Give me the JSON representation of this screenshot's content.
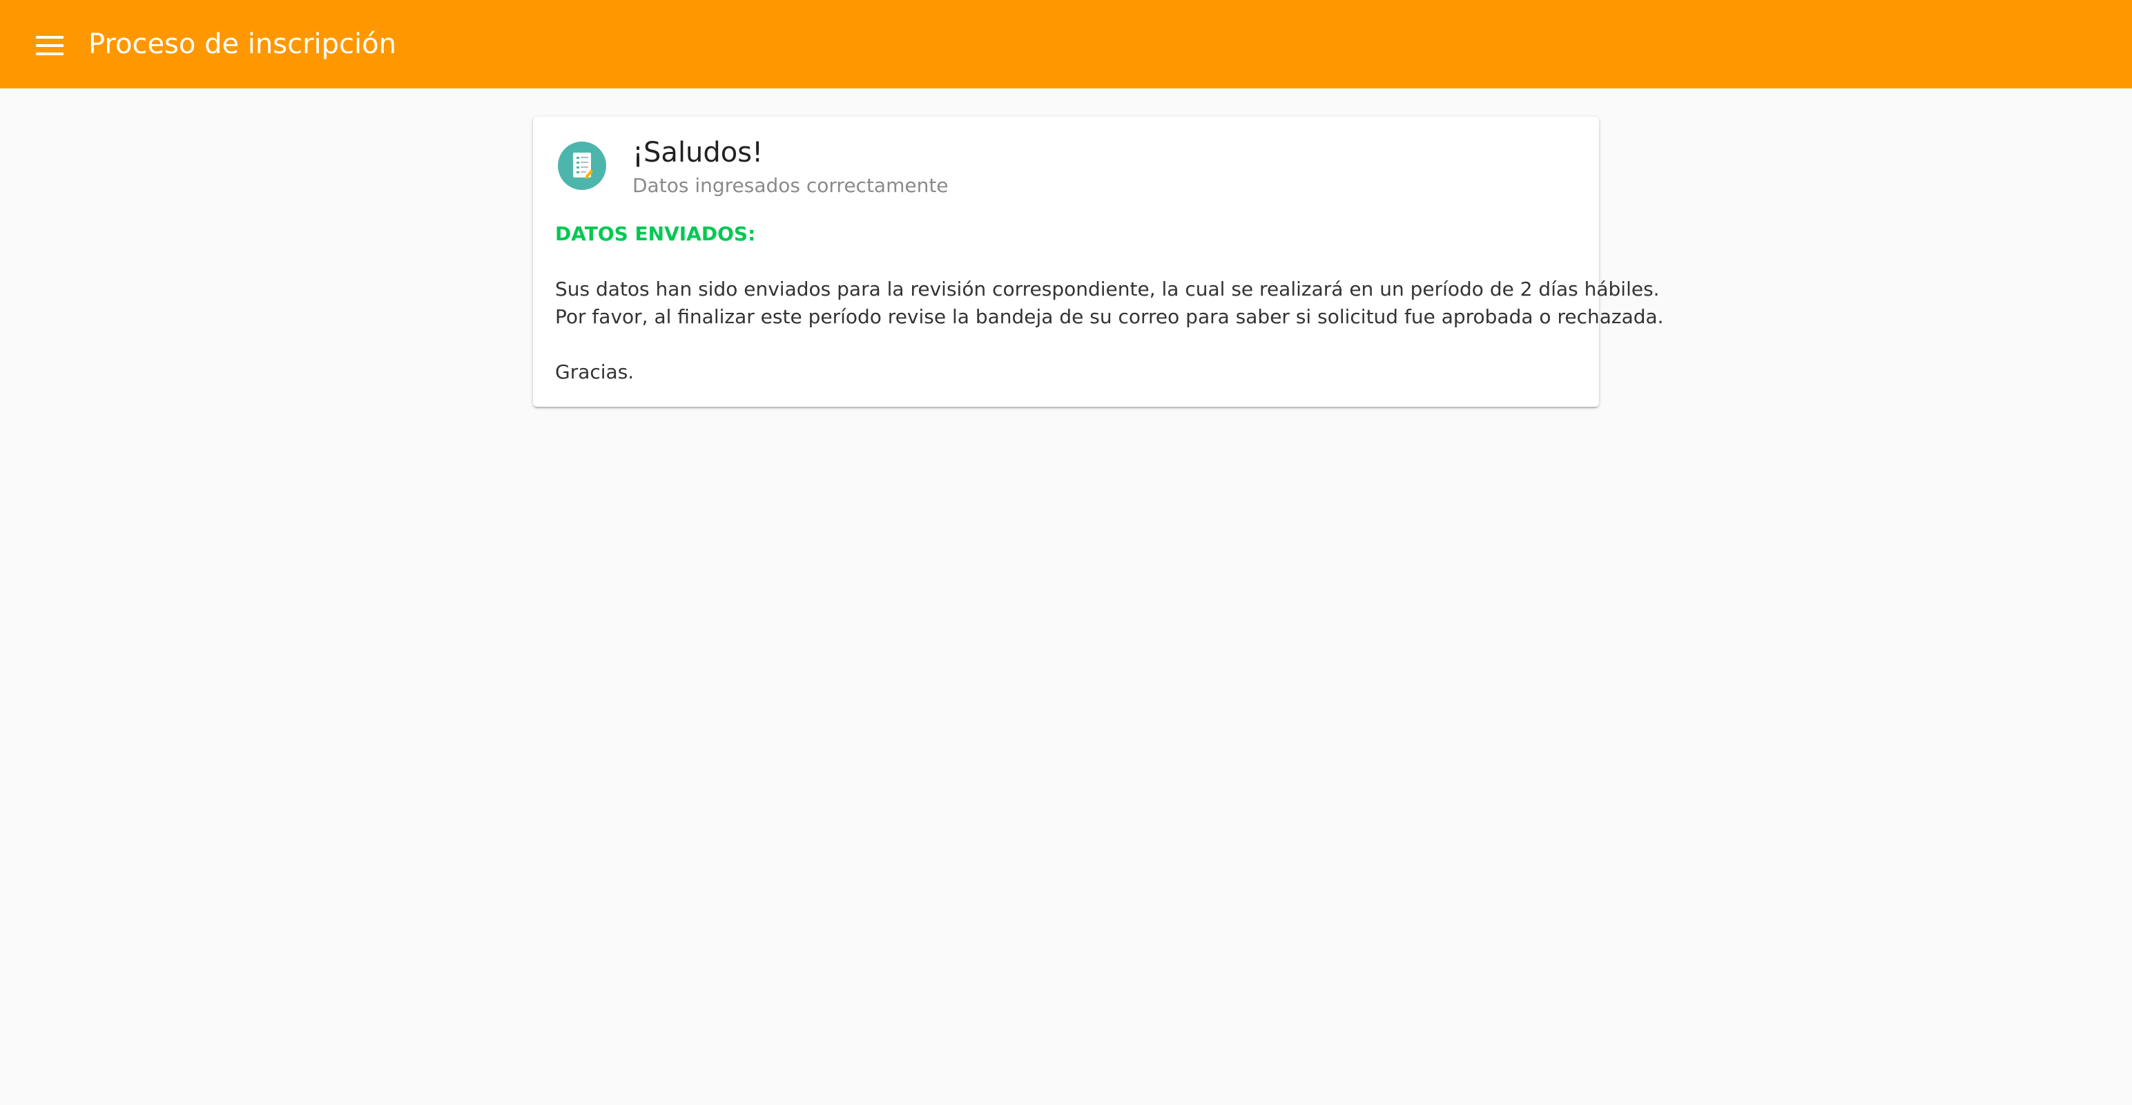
{
  "toolbar": {
    "title": "Proceso de inscripción",
    "menu_icon": "menu-icon",
    "background_color": "#ff9800"
  },
  "card": {
    "avatar_icon": "document-edit-icon",
    "avatar_color": "#4db6ac",
    "title": "¡Saludos!",
    "subtitle": "Datos ingresados correctamente",
    "status_heading": "DATOS ENVIADOS:",
    "status_color": "#00c853",
    "paragraph_line1": "Sus datos han sido enviados para la revisión correspondiente, la cual se realizará en un período de 2 días hábiles.",
    "paragraph_line2": "Por favor, al finalizar este período revise la bandeja de su correo para saber si solicitud fue aprobada o rechazada.",
    "closing": "Gracias."
  }
}
